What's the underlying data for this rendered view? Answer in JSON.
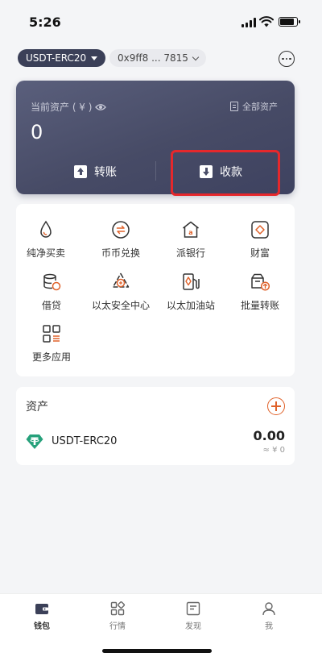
{
  "status_bar": {
    "time": "5:26"
  },
  "wallet": {
    "token_selector": "USDT-ERC20",
    "address": "0x9ff8 ... 7815"
  },
  "asset_card": {
    "label": "当前资产 ( ¥ )",
    "all_assets": "全部资产",
    "value": "0",
    "transfer_label": "转账",
    "receive_label": "收款"
  },
  "apps": [
    {
      "label": "纯净买卖",
      "icon": "drop-icon"
    },
    {
      "label": "币币兑换",
      "icon": "exchange-icon"
    },
    {
      "label": "派银行",
      "icon": "bank-icon"
    },
    {
      "label": "财富",
      "icon": "wealth-icon"
    },
    {
      "label": "借贷",
      "icon": "loan-icon"
    },
    {
      "label": "以太安全中心",
      "icon": "security-center-icon"
    },
    {
      "label": "以太加油站",
      "icon": "gas-station-icon"
    },
    {
      "label": "批量转账",
      "icon": "batch-transfer-icon"
    },
    {
      "label": "更多应用",
      "icon": "more-apps-icon"
    }
  ],
  "assets_list": {
    "title": "资产",
    "items": [
      {
        "name": "USDT-ERC20",
        "amount": "0.00",
        "fiat": "≈ ¥ 0",
        "icon": "tether-icon"
      }
    ]
  },
  "tabbar": [
    {
      "label": "钱包",
      "active": true
    },
    {
      "label": "行情",
      "active": false
    },
    {
      "label": "发现",
      "active": false
    },
    {
      "label": "我",
      "active": false
    }
  ],
  "colors": {
    "card_bg": "#4a4e69",
    "accent_orange": "#e0622a",
    "highlight_red": "#e5282c",
    "tether_green": "#26a17b"
  }
}
